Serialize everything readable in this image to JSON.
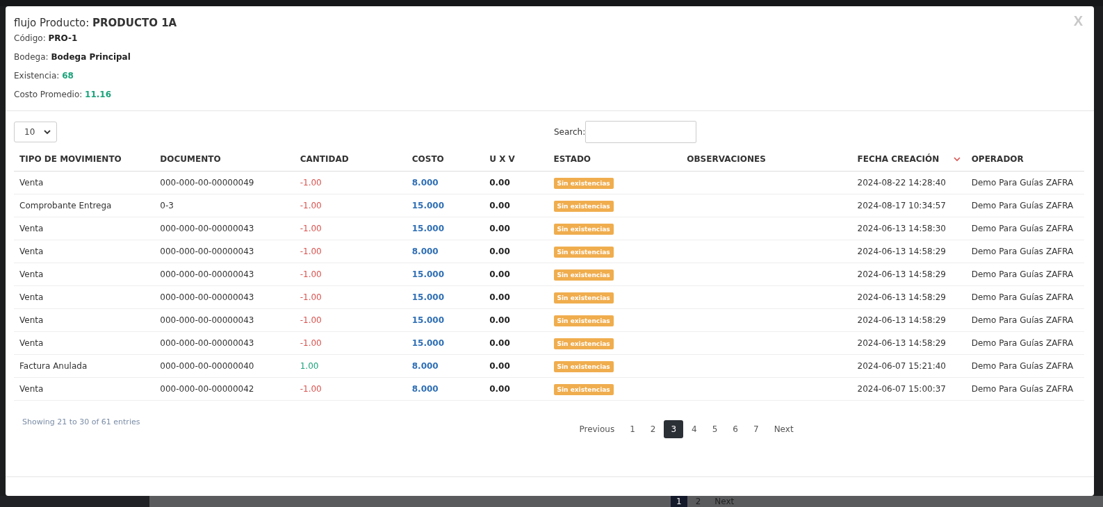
{
  "background": {
    "pagination": [
      {
        "label": "1",
        "selected": true
      },
      {
        "label": "2",
        "selected": false
      },
      {
        "label": "Next",
        "selected": false
      }
    ]
  },
  "modal": {
    "title_prefix": "flujo Producto:",
    "title_name": "PRODUCTO 1A",
    "close": "X",
    "details": [
      {
        "label": "Código:",
        "value": "PRO-1",
        "color": "#222222"
      },
      {
        "label": "Bodega:",
        "value": "Bodega Principal",
        "color": "#222222"
      },
      {
        "label": "Existencia:",
        "value": "68",
        "color": "#1aa37a"
      },
      {
        "label": "Costo Promedio:",
        "value": "11.16",
        "color": "#1aa37a"
      }
    ]
  },
  "table_controls": {
    "page_length": "10",
    "search_label": "Search:"
  },
  "table": {
    "columns": [
      {
        "label": "TIPO DE MOVIMIENTO",
        "sorted": false
      },
      {
        "label": "DOCUMENTO",
        "sorted": false
      },
      {
        "label": "CANTIDAD",
        "sorted": false
      },
      {
        "label": "COSTO",
        "sorted": false
      },
      {
        "label": "U X V",
        "sorted": false
      },
      {
        "label": "ESTADO",
        "sorted": false
      },
      {
        "label": "OBSERVACIONES",
        "sorted": false
      },
      {
        "label": "FECHA CREACIÓN",
        "sorted": true
      },
      {
        "label": "OPERADOR",
        "sorted": false
      }
    ],
    "rows": [
      {
        "tipo": "Venta",
        "documento": "000-000-00-00000049",
        "cantidad": {
          "value": "-1.00",
          "color": "#d9534f"
        },
        "costo": "8.000",
        "uxv": "0.00",
        "estado": "Sin existencias",
        "fecha": "2024-08-22 14:28:40",
        "operador": "Demo Para Guías ZAFRA"
      },
      {
        "tipo": "Comprobante Entrega",
        "documento": "0-3",
        "cantidad": {
          "value": "-1.00",
          "color": "#d9534f"
        },
        "costo": "15.000",
        "uxv": "0.00",
        "estado": "Sin existencias",
        "fecha": "2024-08-17 10:34:57",
        "operador": "Demo Para Guías ZAFRA"
      },
      {
        "tipo": "Venta",
        "documento": "000-000-00-00000043",
        "cantidad": {
          "value": "-1.00",
          "color": "#d9534f"
        },
        "costo": "15.000",
        "uxv": "0.00",
        "estado": "Sin existencias",
        "fecha": "2024-06-13 14:58:30",
        "operador": "Demo Para Guías ZAFRA"
      },
      {
        "tipo": "Venta",
        "documento": "000-000-00-00000043",
        "cantidad": {
          "value": "-1.00",
          "color": "#d9534f"
        },
        "costo": "8.000",
        "uxv": "0.00",
        "estado": "Sin existencias",
        "fecha": "2024-06-13 14:58:29",
        "operador": "Demo Para Guías ZAFRA"
      },
      {
        "tipo": "Venta",
        "documento": "000-000-00-00000043",
        "cantidad": {
          "value": "-1.00",
          "color": "#d9534f"
        },
        "costo": "15.000",
        "uxv": "0.00",
        "estado": "Sin existencias",
        "fecha": "2024-06-13 14:58:29",
        "operador": "Demo Para Guías ZAFRA"
      },
      {
        "tipo": "Venta",
        "documento": "000-000-00-00000043",
        "cantidad": {
          "value": "-1.00",
          "color": "#d9534f"
        },
        "costo": "15.000",
        "uxv": "0.00",
        "estado": "Sin existencias",
        "fecha": "2024-06-13 14:58:29",
        "operador": "Demo Para Guías ZAFRA"
      },
      {
        "tipo": "Venta",
        "documento": "000-000-00-00000043",
        "cantidad": {
          "value": "-1.00",
          "color": "#d9534f"
        },
        "costo": "15.000",
        "uxv": "0.00",
        "estado": "Sin existencias",
        "fecha": "2024-06-13 14:58:29",
        "operador": "Demo Para Guías ZAFRA"
      },
      {
        "tipo": "Venta",
        "documento": "000-000-00-00000043",
        "cantidad": {
          "value": "-1.00",
          "color": "#d9534f"
        },
        "costo": "15.000",
        "uxv": "0.00",
        "estado": "Sin existencias",
        "fecha": "2024-06-13 14:58:29",
        "operador": "Demo Para Guías ZAFRA"
      },
      {
        "tipo": "Factura Anulada",
        "documento": "000-000-00-00000040",
        "cantidad": {
          "value": "1.00",
          "color": "#1aa37a"
        },
        "costo": "8.000",
        "uxv": "0.00",
        "estado": "Sin existencias",
        "fecha": "2024-06-07 15:21:40",
        "operador": "Demo Para Guías ZAFRA"
      },
      {
        "tipo": "Venta",
        "documento": "000-000-00-00000042",
        "cantidad": {
          "value": "-1.00",
          "color": "#d9534f"
        },
        "costo": "8.000",
        "uxv": "0.00",
        "estado": "Sin existencias",
        "fecha": "2024-06-07 15:00:37",
        "operador": "Demo Para Guías ZAFRA"
      }
    ]
  },
  "footer": {
    "info": "Showing 21 to 30 of 61 entries",
    "pagination": [
      {
        "label": "Previous",
        "selected": false
      },
      {
        "label": "1",
        "selected": false
      },
      {
        "label": "2",
        "selected": false
      },
      {
        "label": "3",
        "selected": true
      },
      {
        "label": "4",
        "selected": false
      },
      {
        "label": "5",
        "selected": false
      },
      {
        "label": "6",
        "selected": false
      },
      {
        "label": "7",
        "selected": false
      },
      {
        "label": "Next",
        "selected": false
      }
    ]
  }
}
